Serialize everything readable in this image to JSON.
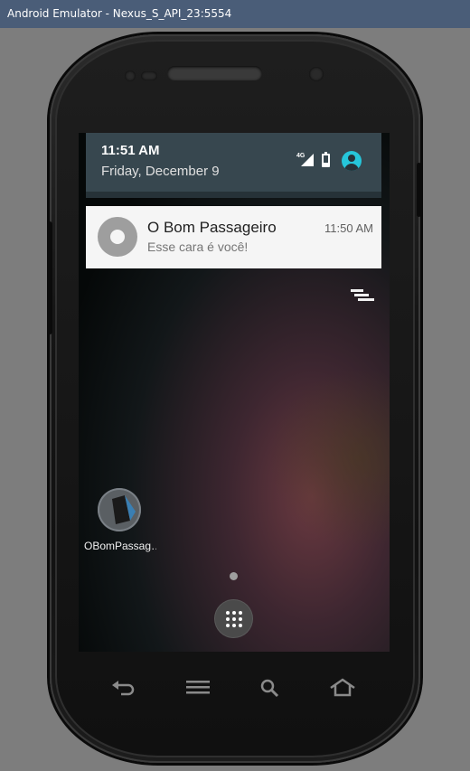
{
  "window": {
    "title": "Android Emulator - Nexus_S_API_23:5554"
  },
  "status": {
    "time": "11:51 AM",
    "date": "Friday, December 9",
    "network_label": "4G"
  },
  "notification": {
    "app_title": "O Bom Passageiro",
    "time": "11:50 AM",
    "text": "Esse cara é você!"
  },
  "home": {
    "app_label": "OBomPassag…"
  },
  "icons": {
    "signal": "signal-icon",
    "battery": "battery-icon",
    "user": "user-icon",
    "clear_all": "clear-all-icon",
    "apps": "app-drawer-icon",
    "back": "back-icon",
    "menu": "menu-icon",
    "search": "search-icon",
    "home": "home-icon"
  },
  "colors": {
    "titlebar": "#4a5d78",
    "shade": "#37474f",
    "accent": "#26c6da",
    "notification_bg": "#f5f5f5"
  }
}
